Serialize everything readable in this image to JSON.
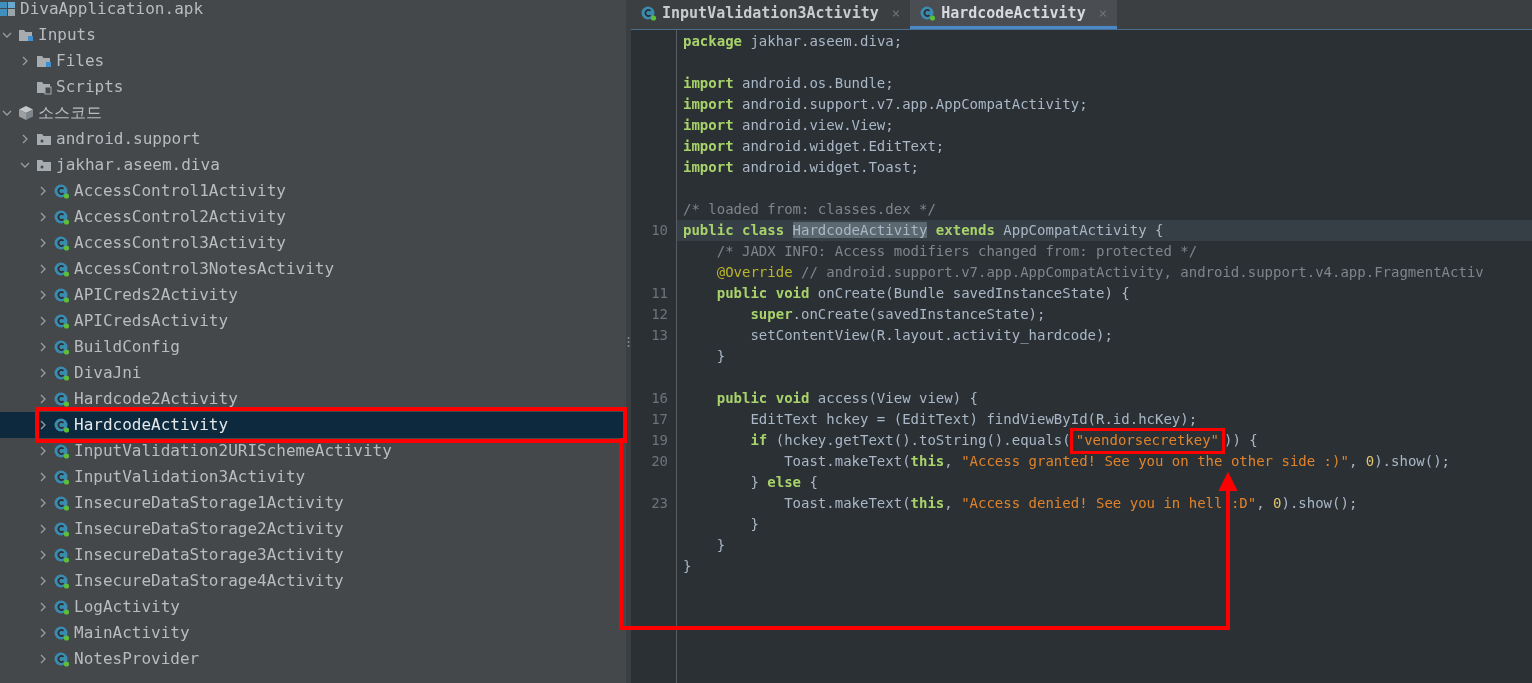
{
  "tree": [
    {
      "label": "DivaApplication.apk",
      "kind": "project",
      "selected": false,
      "children": [
        {
          "label": "Inputs",
          "kind": "inputs",
          "expanded": true,
          "selected": false,
          "children": [
            {
              "label": "Files",
              "kind": "files",
              "expanded": false,
              "selected": false
            },
            {
              "label": "Scripts",
              "kind": "scripts",
              "selected": false
            }
          ]
        },
        {
          "label": "소스코드",
          "kind": "module",
          "expanded": true,
          "selected": false,
          "children": [
            {
              "label": "android.support",
              "kind": "package",
              "expanded": false,
              "selected": false
            },
            {
              "label": "jakhar.aseem.diva",
              "kind": "package",
              "expanded": true,
              "selected": false,
              "children": [
                {
                  "label": "AccessControl1Activity",
                  "kind": "class",
                  "expanded": false,
                  "selected": false
                },
                {
                  "label": "AccessControl2Activity",
                  "kind": "class",
                  "expanded": false,
                  "selected": false
                },
                {
                  "label": "AccessControl3Activity",
                  "kind": "class",
                  "expanded": false,
                  "selected": false
                },
                {
                  "label": "AccessControl3NotesActivity",
                  "kind": "class",
                  "expanded": false,
                  "selected": false
                },
                {
                  "label": "APICreds2Activity",
                  "kind": "class",
                  "expanded": false,
                  "selected": false
                },
                {
                  "label": "APICredsActivity",
                  "kind": "class",
                  "expanded": false,
                  "selected": false
                },
                {
                  "label": "BuildConfig",
                  "kind": "class",
                  "expanded": false,
                  "selected": false
                },
                {
                  "label": "DivaJni",
                  "kind": "class",
                  "expanded": false,
                  "selected": false
                },
                {
                  "label": "Hardcode2Activity",
                  "kind": "class",
                  "expanded": false,
                  "selected": false
                },
                {
                  "label": "HardcodeActivity",
                  "kind": "class",
                  "expanded": false,
                  "selected": true
                },
                {
                  "label": "InputValidation2URISchemeActivity",
                  "kind": "class",
                  "expanded": false,
                  "selected": false
                },
                {
                  "label": "InputValidation3Activity",
                  "kind": "class",
                  "expanded": false,
                  "selected": false
                },
                {
                  "label": "InsecureDataStorage1Activity",
                  "kind": "class",
                  "expanded": false,
                  "selected": false
                },
                {
                  "label": "InsecureDataStorage2Activity",
                  "kind": "class",
                  "expanded": false,
                  "selected": false
                },
                {
                  "label": "InsecureDataStorage3Activity",
                  "kind": "class",
                  "expanded": false,
                  "selected": false
                },
                {
                  "label": "InsecureDataStorage4Activity",
                  "kind": "class",
                  "expanded": false,
                  "selected": false
                },
                {
                  "label": "LogActivity",
                  "kind": "class",
                  "expanded": false,
                  "selected": false
                },
                {
                  "label": "MainActivity",
                  "kind": "class",
                  "expanded": false,
                  "selected": false
                },
                {
                  "label": "NotesProvider",
                  "kind": "class",
                  "expanded": false,
                  "selected": false
                }
              ]
            }
          ]
        }
      ]
    }
  ],
  "tabs": [
    {
      "label": "InputValidation3Activity",
      "close": "×",
      "selected": false
    },
    {
      "label": "HardcodeActivity",
      "close": "×",
      "selected": true
    }
  ],
  "code": [
    {
      "kind": "code",
      "tokens": [
        {
          "kind": "kw",
          "text": "package"
        },
        {
          "kind": "txt",
          "text": " jakhar.aseem.diva;"
        }
      ]
    },
    {
      "kind": "blank"
    },
    {
      "kind": "code",
      "tokens": [
        {
          "kind": "kw",
          "text": "import"
        },
        {
          "kind": "txt",
          "text": " android.os.Bundle;"
        }
      ]
    },
    {
      "kind": "code",
      "tokens": [
        {
          "kind": "kw",
          "text": "import"
        },
        {
          "kind": "txt",
          "text": " android.support.v7.app.AppCompatActivity;"
        }
      ]
    },
    {
      "kind": "code",
      "tokens": [
        {
          "kind": "kw",
          "text": "import"
        },
        {
          "kind": "txt",
          "text": " android.view.View;"
        }
      ]
    },
    {
      "kind": "code",
      "tokens": [
        {
          "kind": "kw",
          "text": "import"
        },
        {
          "kind": "txt",
          "text": " android.widget.EditText;"
        }
      ]
    },
    {
      "kind": "code",
      "tokens": [
        {
          "kind": "kw",
          "text": "import"
        },
        {
          "kind": "txt",
          "text": " android.widget.Toast;"
        }
      ]
    },
    {
      "kind": "blank"
    },
    {
      "kind": "code",
      "tokens": [
        {
          "kind": "com",
          "text": "/* loaded from: classes.dex */"
        }
      ]
    },
    {
      "kind": "code",
      "number": "10",
      "highlighted": true,
      "tokens": [
        {
          "kind": "kw",
          "text": "public class "
        },
        {
          "kind": "sel",
          "text": "HardcodeActivity"
        },
        {
          "kind": "kw",
          "text": " extends"
        },
        {
          "kind": "txt",
          "text": " AppCompatActivity {"
        }
      ]
    },
    {
      "kind": "code",
      "tokens": [
        {
          "kind": "com",
          "text": "    /* JADX INFO: Access modifiers changed from: protected */"
        }
      ]
    },
    {
      "kind": "code",
      "tokens": [
        {
          "kind": "ann",
          "text": "    @Override"
        },
        {
          "kind": "com",
          "text": " // android.support.v7.app.AppCompatActivity, android.support.v4.app.FragmentActiv"
        }
      ]
    },
    {
      "kind": "code",
      "number": "11",
      "tokens": [
        {
          "kind": "kw",
          "text": "    public void"
        },
        {
          "kind": "txt",
          "text": " onCreate(Bundle savedInstanceState) {"
        }
      ]
    },
    {
      "kind": "code",
      "number": "12",
      "tokens": [
        {
          "kind": "kw",
          "text": "        super"
        },
        {
          "kind": "txt",
          "text": ".onCreate(savedInstanceState);"
        }
      ]
    },
    {
      "kind": "code",
      "number": "13",
      "tokens": [
        {
          "kind": "txt",
          "text": "        setContentView(R.layout.activity_hardcode);"
        }
      ]
    },
    {
      "kind": "code",
      "tokens": [
        {
          "kind": "txt",
          "text": "    }"
        }
      ]
    },
    {
      "kind": "blank"
    },
    {
      "kind": "code",
      "number": "16",
      "tokens": [
        {
          "kind": "kw",
          "text": "    public void"
        },
        {
          "kind": "txt",
          "text": " access(View view) {"
        }
      ]
    },
    {
      "kind": "code",
      "number": "17",
      "tokens": [
        {
          "kind": "txt",
          "text": "        EditText hckey = (EditText) findViewById(R.id.hcKey);"
        }
      ]
    },
    {
      "kind": "code",
      "number": "19",
      "tokens": [
        {
          "kind": "kw",
          "text": "        if"
        },
        {
          "kind": "txt",
          "text": " (hckey.getText().toString().equals("
        },
        {
          "kind": "str",
          "text": "\"vendorsecretkey\"",
          "boxed": true
        },
        {
          "kind": "txt",
          "text": ")) {"
        }
      ]
    },
    {
      "kind": "code",
      "number": "20",
      "tokens": [
        {
          "kind": "txt",
          "text": "            Toast.makeText("
        },
        {
          "kind": "kw",
          "text": "this"
        },
        {
          "kind": "txt",
          "text": ", "
        },
        {
          "kind": "str",
          "text": "\"Access granted! See you on the other side :)\""
        },
        {
          "kind": "txt",
          "text": ", "
        },
        {
          "kind": "num",
          "text": "0"
        },
        {
          "kind": "txt",
          "text": ").show();"
        }
      ]
    },
    {
      "kind": "code",
      "tokens": [
        {
          "kind": "txt",
          "text": "        } "
        },
        {
          "kind": "kw",
          "text": "else"
        },
        {
          "kind": "txt",
          "text": " {"
        }
      ]
    },
    {
      "kind": "code",
      "number": "23",
      "tokens": [
        {
          "kind": "txt",
          "text": "            Toast.makeText("
        },
        {
          "kind": "kw",
          "text": "this"
        },
        {
          "kind": "txt",
          "text": ", "
        },
        {
          "kind": "str",
          "text": "\"Access denied! See you in hell :D\""
        },
        {
          "kind": "txt",
          "text": ", "
        },
        {
          "kind": "num",
          "text": "0"
        },
        {
          "kind": "txt",
          "text": ").show();"
        }
      ]
    },
    {
      "kind": "code",
      "tokens": [
        {
          "kind": "txt",
          "text": "        }"
        }
      ]
    },
    {
      "kind": "code",
      "tokens": [
        {
          "kind": "txt",
          "text": "    }"
        }
      ]
    },
    {
      "kind": "code",
      "tokens": [
        {
          "kind": "txt",
          "text": "}"
        }
      ]
    }
  ]
}
